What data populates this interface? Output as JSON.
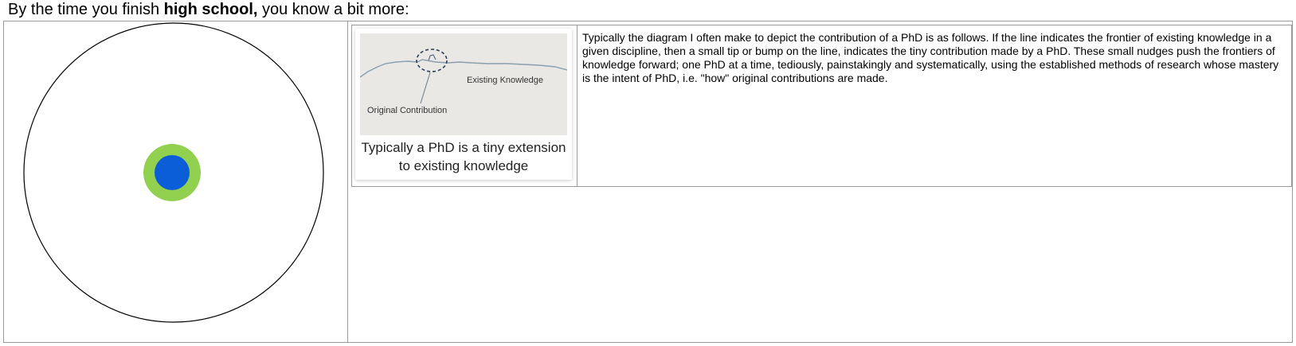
{
  "heading": {
    "prefix": "By the time you finish ",
    "bold": "high school,",
    "suffix": " you know a bit more:"
  },
  "figure": {
    "label_existing": "Existing Knowledge",
    "label_contribution": "Original Contribution",
    "caption": "Typically a PhD is a tiny extension to existing knowledge"
  },
  "paragraph": "Typically the diagram I often make to depict the contribution of a PhD is as follows. If the line indicates the frontier of existing knowledge in a given discipline, then a small tip or bump on the line, indicates the tiny contribution made by a PhD. These small nudges push the frontiers of knowledge forward; one PhD at a time, tediously, painstakingly and systematically, using the established methods of research whose mastery is the intent of PhD, i.e. \"how\" original contributions are made.",
  "colors": {
    "outer_circle_stroke": "#000000",
    "green_ring": "#92d050",
    "blue_core": "#0b5ed7",
    "border": "#9a9a9a"
  }
}
